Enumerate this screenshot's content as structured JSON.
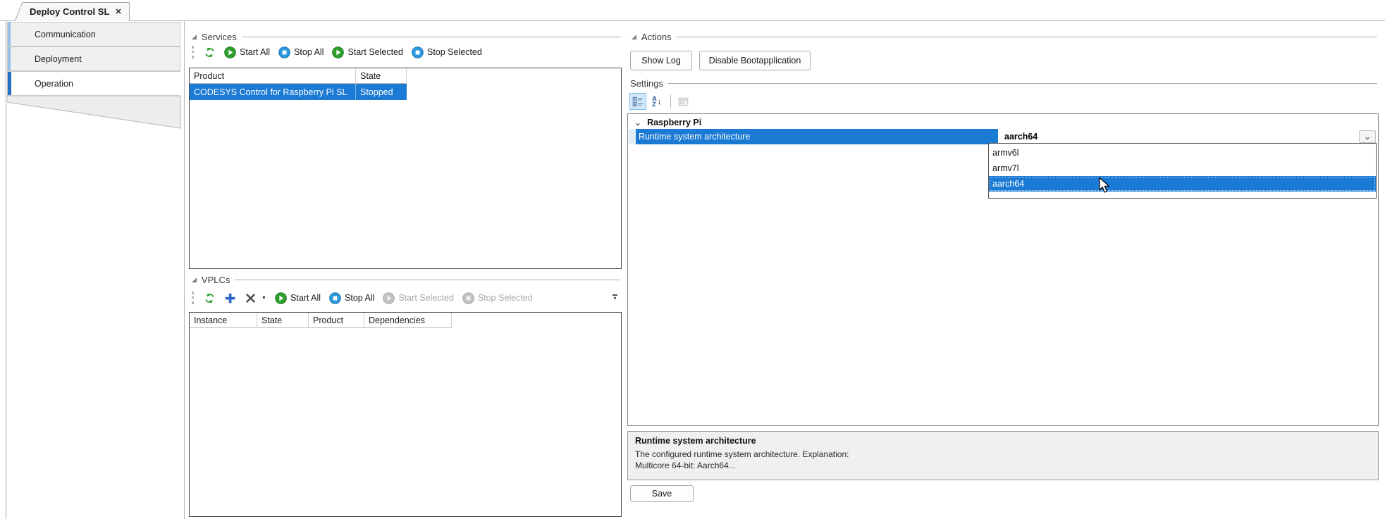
{
  "tab": {
    "title": "Deploy Control SL"
  },
  "icons": {
    "close": "✕",
    "group_triangle": "◢",
    "category_chevron": "⌄",
    "combo_chevron": "⌄",
    "overflow_chevron": "▾",
    "delete_caret": "▼",
    "sort_a": "A",
    "sort_z": "Z",
    "sort_arrow": "↓"
  },
  "sidebar": {
    "items": [
      {
        "label": "Communication"
      },
      {
        "label": "Deployment"
      },
      {
        "label": "Operation"
      }
    ]
  },
  "services": {
    "title": "Services",
    "toolbar": {
      "start_all": "Start All",
      "stop_all": "Stop All",
      "start_selected": "Start Selected",
      "stop_selected": "Stop Selected"
    },
    "table": {
      "columns": [
        "Product",
        "State"
      ],
      "rows": [
        {
          "product": "CODESYS Control for Raspberry Pi SL",
          "state": "Stopped"
        }
      ]
    }
  },
  "vplcs": {
    "title": "VPLCs",
    "toolbar": {
      "start_all": "Start All",
      "stop_all": "Stop All",
      "start_selected": "Start Selected",
      "stop_selected": "Stop Selected"
    },
    "table": {
      "columns": [
        "Instance",
        "State",
        "Product",
        "Dependencies"
      ],
      "rows": []
    }
  },
  "actions": {
    "title": "Actions",
    "buttons": {
      "show_log": "Show Log",
      "disable_boot": "Disable Bootapplication"
    }
  },
  "settings": {
    "title": "Settings",
    "category": "Raspberry Pi",
    "property": {
      "name": "Runtime system architecture",
      "value": "aarch64"
    },
    "dropdown": {
      "options": [
        "armv6l",
        "armv7l",
        "aarch64"
      ],
      "selected": "aarch64"
    },
    "description": {
      "title": "Runtime system architecture",
      "line1": "The configured runtime system architecture. Explanation:",
      "line2": "Multicore 64-bit: Aarch64..."
    },
    "save_label": "Save"
  },
  "colors": {
    "selection_blue": "#1a7ad4",
    "sidebar_strip_selected": "#1f6fc4",
    "sidebar_strip": "#93bfe9",
    "start_green": "#2da02d",
    "stop_blue": "#2b9ade",
    "add_blue": "#2d66cc",
    "panel_gray": "#f0f0f0"
  }
}
